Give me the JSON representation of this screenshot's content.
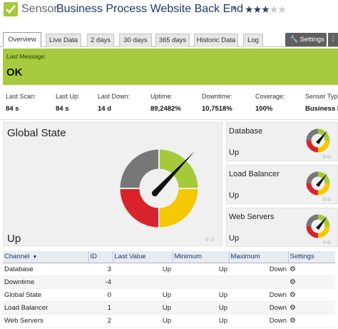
{
  "header": {
    "prefix": "Sensor",
    "name": "Business Process Website Back End",
    "flag_icon": "flag-icon",
    "stars_filled": 3,
    "stars_total": 5
  },
  "tabs": [
    {
      "label": "Overview",
      "active": true
    },
    {
      "label": "Live Data"
    },
    {
      "label": "2 days"
    },
    {
      "label": "30 days"
    },
    {
      "label": "365 days"
    },
    {
      "label": "Historic Data"
    },
    {
      "label": "Log"
    }
  ],
  "settings_button": "Settings",
  "message": {
    "label": "Last Message:",
    "value": "OK"
  },
  "stats": [
    {
      "label": "Last Scan:",
      "value": "84 s"
    },
    {
      "label": "Last Up:",
      "value": "84 s"
    },
    {
      "label": "Last Down:",
      "value": "14 d"
    },
    {
      "label": "Uptime:",
      "value": "89,2482%"
    },
    {
      "label": "Downtime:",
      "value": "10,7518%"
    },
    {
      "label": "Coverage:",
      "value": "100%"
    },
    {
      "label": "Sensor Typ",
      "value": "Business P"
    }
  ],
  "global_state": {
    "title": "Global State",
    "status": "Up"
  },
  "small_gauges": [
    {
      "title": "Database",
      "status": "Up"
    },
    {
      "title": "Load Balancer",
      "status": "Up"
    },
    {
      "title": "Web Servers",
      "status": "Up"
    }
  ],
  "table": {
    "headers": [
      "Channel",
      "ID",
      "Last Value",
      "Minimum",
      "Maximum",
      "Settings"
    ],
    "rows": [
      [
        "Database",
        "3",
        "Up",
        "Up",
        "Down"
      ],
      [
        "Downtime",
        "-4",
        "",
        "",
        ""
      ],
      [
        "Global State",
        "0",
        "Up",
        "Up",
        "Down"
      ],
      [
        "Load Balancer",
        "1",
        "Up",
        "Up",
        "Down"
      ],
      [
        "Web Servers",
        "2",
        "Up",
        "Up",
        "Down"
      ]
    ]
  },
  "colors": {
    "accent_green": "#a7ca3e",
    "gauge_gray": "#777777",
    "gauge_green": "#a5c93b",
    "gauge_yellow": "#f5c800",
    "gauge_red": "#d9232a"
  }
}
